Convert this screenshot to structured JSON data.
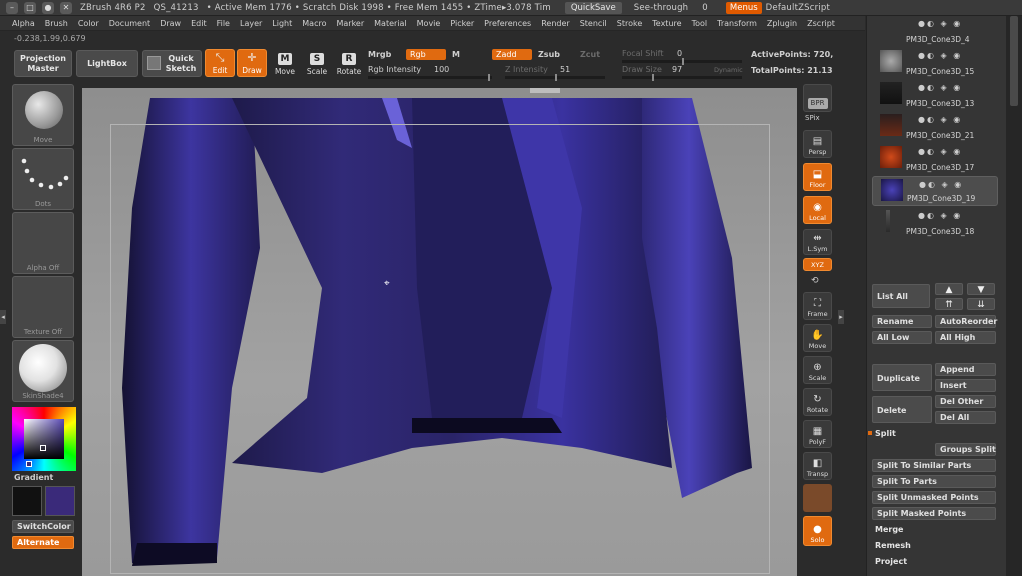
{
  "titlebar": {
    "app": "ZBrush 4R6 P2",
    "qs": "QS_41213",
    "mem_info": "• Active Mem 1776 • Scratch Disk 1998 • Free Mem 1455 • ZTime▸3.078 Tim",
    "quicksave": "QuickSave",
    "see_through": "See-through",
    "see_through_value": "0",
    "menus": "Menus",
    "default_zscript": "DefaultZScript"
  },
  "menus": [
    "Alpha",
    "Brush",
    "Color",
    "Document",
    "Draw",
    "Edit",
    "File",
    "Layer",
    "Light",
    "Macro",
    "Marker",
    "Material",
    "Movie",
    "Picker",
    "Preferences",
    "Render",
    "Stencil",
    "Stroke",
    "Texture",
    "Tool",
    "Transform",
    "Zplugin",
    "Zscript"
  ],
  "coords": "-0.238,1.99,0.679",
  "shelf": {
    "projection_master": "Projection Master",
    "lightbox": "LightBox",
    "quick_sketch": "Quick Sketch",
    "edit": "Edit",
    "draw": "Draw",
    "move": "Move",
    "scale": "Scale",
    "rotate": "Rotate",
    "mrgb": "Mrgb",
    "rgb": "Rgb",
    "m": "M",
    "zadd": "Zadd",
    "zsub": "Zsub",
    "zcut": "Zcut",
    "rgb_intensity_label": "Rgb Intensity",
    "rgb_intensity_value": "100",
    "z_intensity_label": "Z Intensity",
    "z_intensity_value": "51",
    "focal_shift_label": "Focal Shift",
    "focal_shift_value": "0",
    "draw_size_label": "Draw Size",
    "draw_size_value": "97",
    "dynamic": "Dynamic",
    "active_points": "ActivePoints: 720,",
    "total_points": "TotalPoints: 21.13"
  },
  "left_palette": {
    "brush": "Move",
    "stroke": "Dots",
    "alpha": "Alpha Off",
    "texture": "Texture Off",
    "material": "SkinShade4",
    "gradient": "Gradient",
    "switch_color": "SwitchColor",
    "alternate": "Alternate",
    "primary_color": "#111111",
    "secondary_color": "#3a2a7a"
  },
  "right_shelf": [
    "BPR",
    "SPix",
    "Persp",
    "Floor",
    "Local",
    "L.Sym",
    "XYZ",
    "Frame",
    "Move",
    "Scale",
    "Rotate",
    "PolyF",
    "Transp",
    "Solo"
  ],
  "subtools": [
    {
      "name": "PM3D_Cone3D_4",
      "selected": false
    },
    {
      "name": "PM3D_Cone3D_15",
      "selected": false
    },
    {
      "name": "PM3D_Cone3D_13",
      "selected": false
    },
    {
      "name": "PM3D_Cone3D_21",
      "selected": false
    },
    {
      "name": "PM3D_Cone3D_17",
      "selected": false
    },
    {
      "name": "PM3D_Cone3D_19",
      "selected": true
    },
    {
      "name": "PM3D_Cone3D_18",
      "selected": false
    }
  ],
  "subtool_panel": {
    "list_all": "List All",
    "rename": "Rename",
    "auto_reorder": "AutoReorder",
    "all_low": "All Low",
    "all_high": "All High",
    "duplicate": "Duplicate",
    "append": "Append",
    "insert": "Insert",
    "delete": "Delete",
    "del_other": "Del Other",
    "del_all": "Del All",
    "split": "Split",
    "groups_split": "Groups Split",
    "split_similar": "Split To Similar Parts",
    "split_parts": "Split To Parts",
    "split_unmasked": "Split Unmasked Points",
    "split_masked": "Split Masked Points",
    "merge": "Merge",
    "remesh": "Remesh",
    "project": "Project"
  }
}
